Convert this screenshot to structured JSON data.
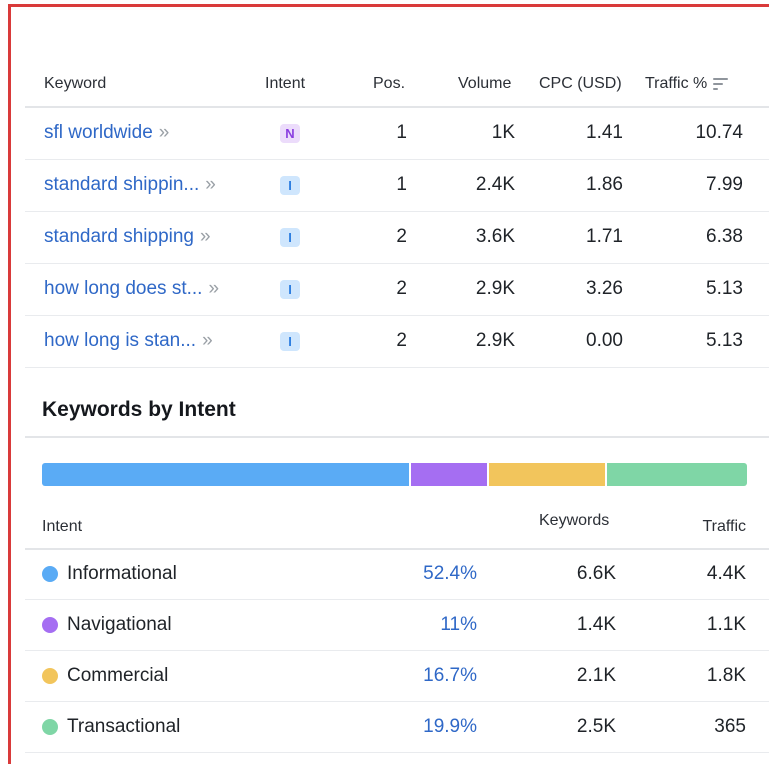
{
  "keywords_table": {
    "headers": {
      "keyword": "Keyword",
      "intent": "Intent",
      "pos": "Pos.",
      "volume": "Volume",
      "cpc": "CPC (USD)",
      "traffic": "Traffic %"
    },
    "rows": [
      {
        "keyword": "sfl worldwide",
        "chevron": "»",
        "intent": "N",
        "pos": "1",
        "volume": "1K",
        "cpc": "1.41",
        "traffic": "10.74"
      },
      {
        "keyword": "standard shippin...",
        "chevron": "»",
        "intent": "I",
        "pos": "1",
        "volume": "2.4K",
        "cpc": "1.86",
        "traffic": "7.99"
      },
      {
        "keyword": "standard shipping",
        "chevron": "»",
        "intent": "I",
        "pos": "2",
        "volume": "3.6K",
        "cpc": "1.71",
        "traffic": "6.38"
      },
      {
        "keyword": "how long does st...",
        "chevron": "»",
        "intent": "I",
        "pos": "2",
        "volume": "2.9K",
        "cpc": "3.26",
        "traffic": "5.13"
      },
      {
        "keyword": "how long is stan...",
        "chevron": "»",
        "intent": "I",
        "pos": "2",
        "volume": "2.9K",
        "cpc": "0.00",
        "traffic": "5.13"
      }
    ]
  },
  "keywords_by_intent": {
    "title": "Keywords by Intent",
    "headers": {
      "intent": "Intent",
      "keywords": "Keywords",
      "traffic": "Traffic"
    },
    "rows": [
      {
        "name": "Informational",
        "share": "52.4%",
        "share_value": 52.4,
        "keywords": "6.6K",
        "traffic": "4.4K",
        "color": "#5aabf5"
      },
      {
        "name": "Navigational",
        "share": "11%",
        "share_value": 11,
        "keywords": "1.4K",
        "traffic": "1.1K",
        "color": "#a56ef2"
      },
      {
        "name": "Commercial",
        "share": "16.7%",
        "share_value": 16.7,
        "keywords": "2.1K",
        "traffic": "1.8K",
        "color": "#f2c55c"
      },
      {
        "name": "Transactional",
        "share": "19.9%",
        "share_value": 19.9,
        "keywords": "2.5K",
        "traffic": "365",
        "color": "#7fd6a6"
      }
    ]
  },
  "colors": {
    "link": "#2f68c7",
    "frame_border": "#d93a3a",
    "badge_n_bg": "#ecdcfb",
    "badge_n_fg": "#8a3ee0",
    "badge_i_bg": "#cfe6fd",
    "badge_i_fg": "#2f7fe0"
  },
  "icons": {
    "sort": "sort-descending-icon",
    "chevron": "double-chevron-right-icon"
  }
}
